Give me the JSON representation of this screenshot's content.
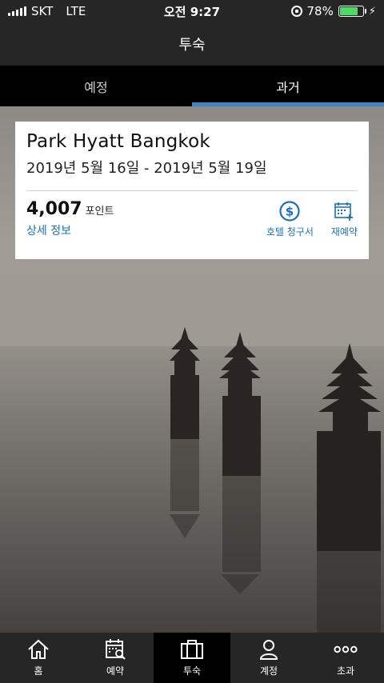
{
  "status_bar": {
    "carrier": "SKT",
    "network": "LTE",
    "time": "오전 9:27",
    "battery_percent": "78%",
    "battery_level": 0.78
  },
  "header": {
    "title": "투숙"
  },
  "tabs": [
    {
      "label": "예정",
      "active": false
    },
    {
      "label": "과거",
      "active": true
    }
  ],
  "stay_card": {
    "hotel_name": "Park Hyatt Bangkok",
    "dates": "2019년 5월 16일 - 2019년 5월 19일",
    "points_value": "4,007",
    "points_unit": "포인트",
    "details_link": "상세 정보",
    "actions": [
      {
        "label": "호텔 청구서",
        "icon": "dollar-icon"
      },
      {
        "label": "재예약",
        "icon": "calendar-add-icon"
      }
    ]
  },
  "colors": {
    "accent": "#1f6fb5",
    "tab_indicator": "#3a86c8",
    "battery": "#4cd964"
  },
  "bottom_nav": [
    {
      "label": "홈",
      "icon": "home-icon",
      "active": false
    },
    {
      "label": "예약",
      "icon": "calendar-search-icon",
      "active": false
    },
    {
      "label": "투숙",
      "icon": "suitcase-icon",
      "active": true
    },
    {
      "label": "계정",
      "icon": "person-icon",
      "active": false
    },
    {
      "label": "초과",
      "icon": "more-icon",
      "active": false
    }
  ]
}
